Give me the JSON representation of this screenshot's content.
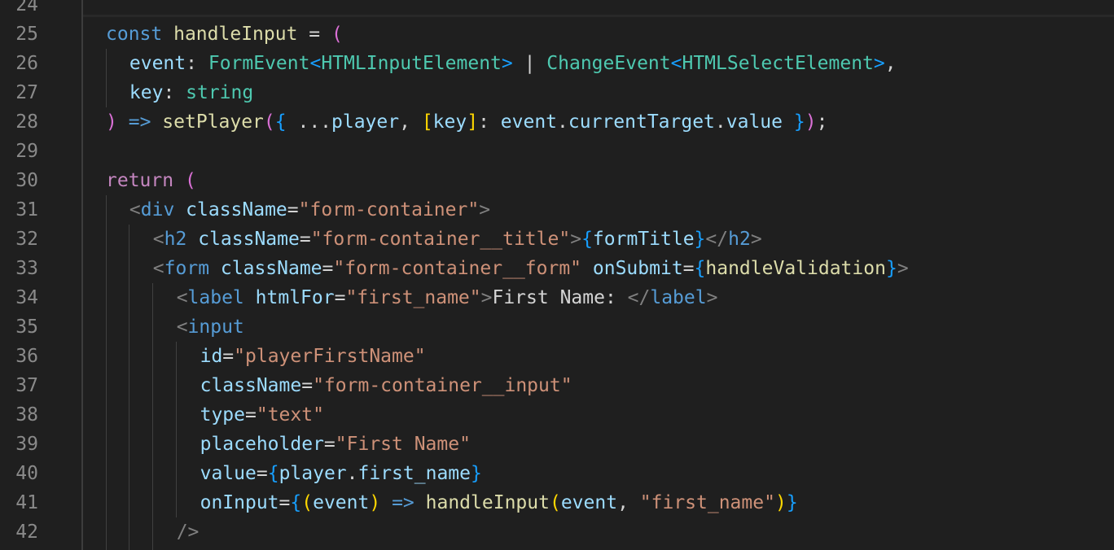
{
  "editor": {
    "top_line_number": "24",
    "lines": [
      {
        "num": "25",
        "tokens": [
          {
            "t": "const",
            "c": "kw"
          },
          {
            "t": " ",
            "c": "txt"
          },
          {
            "t": "handleInput",
            "c": "fn"
          },
          {
            "t": " = ",
            "c": "txt"
          },
          {
            "t": "(",
            "c": "b1"
          }
        ]
      },
      {
        "num": "26",
        "tokens": [
          {
            "t": "event",
            "c": "var"
          },
          {
            "t": ": ",
            "c": "txt"
          },
          {
            "t": "FormEvent",
            "c": "type"
          },
          {
            "t": "<",
            "c": "b2"
          },
          {
            "t": "HTMLInputElement",
            "c": "type"
          },
          {
            "t": ">",
            "c": "b2"
          },
          {
            "t": " | ",
            "c": "txt"
          },
          {
            "t": "ChangeEvent",
            "c": "type"
          },
          {
            "t": "<",
            "c": "b2"
          },
          {
            "t": "HTMLSelectElement",
            "c": "type"
          },
          {
            "t": ">",
            "c": "b2"
          },
          {
            "t": ",",
            "c": "txt"
          }
        ]
      },
      {
        "num": "27",
        "tokens": [
          {
            "t": "key",
            "c": "var"
          },
          {
            "t": ": ",
            "c": "txt"
          },
          {
            "t": "string",
            "c": "type"
          }
        ]
      },
      {
        "num": "28",
        "tokens": [
          {
            "t": ")",
            "c": "b1"
          },
          {
            "t": " ",
            "c": "txt"
          },
          {
            "t": "=>",
            "c": "kw"
          },
          {
            "t": " ",
            "c": "txt"
          },
          {
            "t": "setPlayer",
            "c": "fn"
          },
          {
            "t": "(",
            "c": "b1"
          },
          {
            "t": "{",
            "c": "b2"
          },
          {
            "t": " ...",
            "c": "txt"
          },
          {
            "t": "player",
            "c": "var"
          },
          {
            "t": ", ",
            "c": "txt"
          },
          {
            "t": "[",
            "c": "b3"
          },
          {
            "t": "key",
            "c": "var"
          },
          {
            "t": "]",
            "c": "b3"
          },
          {
            "t": ": ",
            "c": "txt"
          },
          {
            "t": "event",
            "c": "var"
          },
          {
            "t": ".",
            "c": "txt"
          },
          {
            "t": "currentTarget",
            "c": "var"
          },
          {
            "t": ".",
            "c": "txt"
          },
          {
            "t": "value",
            "c": "var"
          },
          {
            "t": " ",
            "c": "txt"
          },
          {
            "t": "}",
            "c": "b2"
          },
          {
            "t": ")",
            "c": "b1"
          },
          {
            "t": ";",
            "c": "txt"
          }
        ]
      },
      {
        "num": "29",
        "tokens": []
      },
      {
        "num": "30",
        "tokens": [
          {
            "t": "return",
            "c": "ctrl"
          },
          {
            "t": " ",
            "c": "txt"
          },
          {
            "t": "(",
            "c": "b1"
          }
        ]
      },
      {
        "num": "31",
        "tokens": [
          {
            "t": "<",
            "c": "pun"
          },
          {
            "t": "div",
            "c": "tag"
          },
          {
            "t": " ",
            "c": "txt"
          },
          {
            "t": "className",
            "c": "var"
          },
          {
            "t": "=",
            "c": "txt"
          },
          {
            "t": "\"form-container\"",
            "c": "str"
          },
          {
            "t": ">",
            "c": "pun"
          }
        ]
      },
      {
        "num": "32",
        "tokens": [
          {
            "t": "<",
            "c": "pun"
          },
          {
            "t": "h2",
            "c": "tag"
          },
          {
            "t": " ",
            "c": "txt"
          },
          {
            "t": "className",
            "c": "var"
          },
          {
            "t": "=",
            "c": "txt"
          },
          {
            "t": "\"form-container__title\"",
            "c": "str"
          },
          {
            "t": ">",
            "c": "pun"
          },
          {
            "t": "{",
            "c": "b2"
          },
          {
            "t": "formTitle",
            "c": "var"
          },
          {
            "t": "}",
            "c": "b2"
          },
          {
            "t": "</",
            "c": "pun"
          },
          {
            "t": "h2",
            "c": "tag"
          },
          {
            "t": ">",
            "c": "pun"
          }
        ]
      },
      {
        "num": "33",
        "tokens": [
          {
            "t": "<",
            "c": "pun"
          },
          {
            "t": "form",
            "c": "tag"
          },
          {
            "t": " ",
            "c": "txt"
          },
          {
            "t": "className",
            "c": "var"
          },
          {
            "t": "=",
            "c": "txt"
          },
          {
            "t": "\"form-container__form\"",
            "c": "str"
          },
          {
            "t": " ",
            "c": "txt"
          },
          {
            "t": "onSubmit",
            "c": "var"
          },
          {
            "t": "=",
            "c": "txt"
          },
          {
            "t": "{",
            "c": "b2"
          },
          {
            "t": "handleValidation",
            "c": "fn"
          },
          {
            "t": "}",
            "c": "b2"
          },
          {
            "t": ">",
            "c": "pun"
          }
        ]
      },
      {
        "num": "34",
        "tokens": [
          {
            "t": "<",
            "c": "pun"
          },
          {
            "t": "label",
            "c": "tag"
          },
          {
            "t": " ",
            "c": "txt"
          },
          {
            "t": "htmlFor",
            "c": "var"
          },
          {
            "t": "=",
            "c": "txt"
          },
          {
            "t": "\"first_name\"",
            "c": "str"
          },
          {
            "t": ">",
            "c": "pun"
          },
          {
            "t": "First Name: ",
            "c": "txt"
          },
          {
            "t": "</",
            "c": "pun"
          },
          {
            "t": "label",
            "c": "tag"
          },
          {
            "t": ">",
            "c": "pun"
          }
        ]
      },
      {
        "num": "35",
        "tokens": [
          {
            "t": "<",
            "c": "pun"
          },
          {
            "t": "input",
            "c": "tag"
          }
        ]
      },
      {
        "num": "36",
        "tokens": [
          {
            "t": "id",
            "c": "var"
          },
          {
            "t": "=",
            "c": "txt"
          },
          {
            "t": "\"playerFirstName\"",
            "c": "str"
          }
        ]
      },
      {
        "num": "37",
        "tokens": [
          {
            "t": "className",
            "c": "var"
          },
          {
            "t": "=",
            "c": "txt"
          },
          {
            "t": "\"form-container__input\"",
            "c": "str"
          }
        ]
      },
      {
        "num": "38",
        "tokens": [
          {
            "t": "type",
            "c": "var"
          },
          {
            "t": "=",
            "c": "txt"
          },
          {
            "t": "\"text\"",
            "c": "str"
          }
        ]
      },
      {
        "num": "39",
        "tokens": [
          {
            "t": "placeholder",
            "c": "var"
          },
          {
            "t": "=",
            "c": "txt"
          },
          {
            "t": "\"First Name\"",
            "c": "str"
          }
        ]
      },
      {
        "num": "40",
        "tokens": [
          {
            "t": "value",
            "c": "var"
          },
          {
            "t": "=",
            "c": "txt"
          },
          {
            "t": "{",
            "c": "b2"
          },
          {
            "t": "player",
            "c": "var"
          },
          {
            "t": ".",
            "c": "txt"
          },
          {
            "t": "first_name",
            "c": "var"
          },
          {
            "t": "}",
            "c": "b2"
          }
        ]
      },
      {
        "num": "41",
        "tokens": [
          {
            "t": "onInput",
            "c": "var"
          },
          {
            "t": "=",
            "c": "txt"
          },
          {
            "t": "{",
            "c": "b2"
          },
          {
            "t": "(",
            "c": "b3"
          },
          {
            "t": "event",
            "c": "var"
          },
          {
            "t": ")",
            "c": "b3"
          },
          {
            "t": " ",
            "c": "txt"
          },
          {
            "t": "=>",
            "c": "kw"
          },
          {
            "t": " ",
            "c": "txt"
          },
          {
            "t": "handleInput",
            "c": "fn"
          },
          {
            "t": "(",
            "c": "b3"
          },
          {
            "t": "event",
            "c": "var"
          },
          {
            "t": ", ",
            "c": "txt"
          },
          {
            "t": "\"first_name\"",
            "c": "str"
          },
          {
            "t": ")",
            "c": "b3"
          },
          {
            "t": "}",
            "c": "b2"
          }
        ]
      },
      {
        "num": "42",
        "tokens": [
          {
            "t": "/>",
            "c": "pun"
          }
        ]
      }
    ]
  }
}
